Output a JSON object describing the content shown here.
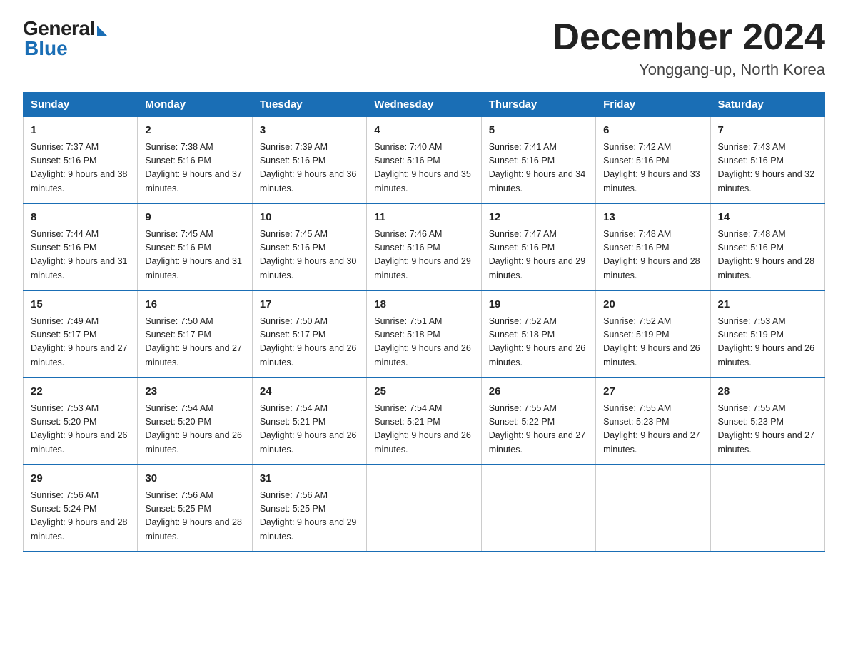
{
  "logo": {
    "general": "General",
    "blue": "Blue"
  },
  "title": "December 2024",
  "location": "Yonggang-up, North Korea",
  "days_of_week": [
    "Sunday",
    "Monday",
    "Tuesday",
    "Wednesday",
    "Thursday",
    "Friday",
    "Saturday"
  ],
  "weeks": [
    [
      {
        "day": "1",
        "sunrise": "Sunrise: 7:37 AM",
        "sunset": "Sunset: 5:16 PM",
        "daylight": "Daylight: 9 hours and 38 minutes."
      },
      {
        "day": "2",
        "sunrise": "Sunrise: 7:38 AM",
        "sunset": "Sunset: 5:16 PM",
        "daylight": "Daylight: 9 hours and 37 minutes."
      },
      {
        "day": "3",
        "sunrise": "Sunrise: 7:39 AM",
        "sunset": "Sunset: 5:16 PM",
        "daylight": "Daylight: 9 hours and 36 minutes."
      },
      {
        "day": "4",
        "sunrise": "Sunrise: 7:40 AM",
        "sunset": "Sunset: 5:16 PM",
        "daylight": "Daylight: 9 hours and 35 minutes."
      },
      {
        "day": "5",
        "sunrise": "Sunrise: 7:41 AM",
        "sunset": "Sunset: 5:16 PM",
        "daylight": "Daylight: 9 hours and 34 minutes."
      },
      {
        "day": "6",
        "sunrise": "Sunrise: 7:42 AM",
        "sunset": "Sunset: 5:16 PM",
        "daylight": "Daylight: 9 hours and 33 minutes."
      },
      {
        "day": "7",
        "sunrise": "Sunrise: 7:43 AM",
        "sunset": "Sunset: 5:16 PM",
        "daylight": "Daylight: 9 hours and 32 minutes."
      }
    ],
    [
      {
        "day": "8",
        "sunrise": "Sunrise: 7:44 AM",
        "sunset": "Sunset: 5:16 PM",
        "daylight": "Daylight: 9 hours and 31 minutes."
      },
      {
        "day": "9",
        "sunrise": "Sunrise: 7:45 AM",
        "sunset": "Sunset: 5:16 PM",
        "daylight": "Daylight: 9 hours and 31 minutes."
      },
      {
        "day": "10",
        "sunrise": "Sunrise: 7:45 AM",
        "sunset": "Sunset: 5:16 PM",
        "daylight": "Daylight: 9 hours and 30 minutes."
      },
      {
        "day": "11",
        "sunrise": "Sunrise: 7:46 AM",
        "sunset": "Sunset: 5:16 PM",
        "daylight": "Daylight: 9 hours and 29 minutes."
      },
      {
        "day": "12",
        "sunrise": "Sunrise: 7:47 AM",
        "sunset": "Sunset: 5:16 PM",
        "daylight": "Daylight: 9 hours and 29 minutes."
      },
      {
        "day": "13",
        "sunrise": "Sunrise: 7:48 AM",
        "sunset": "Sunset: 5:16 PM",
        "daylight": "Daylight: 9 hours and 28 minutes."
      },
      {
        "day": "14",
        "sunrise": "Sunrise: 7:48 AM",
        "sunset": "Sunset: 5:16 PM",
        "daylight": "Daylight: 9 hours and 28 minutes."
      }
    ],
    [
      {
        "day": "15",
        "sunrise": "Sunrise: 7:49 AM",
        "sunset": "Sunset: 5:17 PM",
        "daylight": "Daylight: 9 hours and 27 minutes."
      },
      {
        "day": "16",
        "sunrise": "Sunrise: 7:50 AM",
        "sunset": "Sunset: 5:17 PM",
        "daylight": "Daylight: 9 hours and 27 minutes."
      },
      {
        "day": "17",
        "sunrise": "Sunrise: 7:50 AM",
        "sunset": "Sunset: 5:17 PM",
        "daylight": "Daylight: 9 hours and 26 minutes."
      },
      {
        "day": "18",
        "sunrise": "Sunrise: 7:51 AM",
        "sunset": "Sunset: 5:18 PM",
        "daylight": "Daylight: 9 hours and 26 minutes."
      },
      {
        "day": "19",
        "sunrise": "Sunrise: 7:52 AM",
        "sunset": "Sunset: 5:18 PM",
        "daylight": "Daylight: 9 hours and 26 minutes."
      },
      {
        "day": "20",
        "sunrise": "Sunrise: 7:52 AM",
        "sunset": "Sunset: 5:19 PM",
        "daylight": "Daylight: 9 hours and 26 minutes."
      },
      {
        "day": "21",
        "sunrise": "Sunrise: 7:53 AM",
        "sunset": "Sunset: 5:19 PM",
        "daylight": "Daylight: 9 hours and 26 minutes."
      }
    ],
    [
      {
        "day": "22",
        "sunrise": "Sunrise: 7:53 AM",
        "sunset": "Sunset: 5:20 PM",
        "daylight": "Daylight: 9 hours and 26 minutes."
      },
      {
        "day": "23",
        "sunrise": "Sunrise: 7:54 AM",
        "sunset": "Sunset: 5:20 PM",
        "daylight": "Daylight: 9 hours and 26 minutes."
      },
      {
        "day": "24",
        "sunrise": "Sunrise: 7:54 AM",
        "sunset": "Sunset: 5:21 PM",
        "daylight": "Daylight: 9 hours and 26 minutes."
      },
      {
        "day": "25",
        "sunrise": "Sunrise: 7:54 AM",
        "sunset": "Sunset: 5:21 PM",
        "daylight": "Daylight: 9 hours and 26 minutes."
      },
      {
        "day": "26",
        "sunrise": "Sunrise: 7:55 AM",
        "sunset": "Sunset: 5:22 PM",
        "daylight": "Daylight: 9 hours and 27 minutes."
      },
      {
        "day": "27",
        "sunrise": "Sunrise: 7:55 AM",
        "sunset": "Sunset: 5:23 PM",
        "daylight": "Daylight: 9 hours and 27 minutes."
      },
      {
        "day": "28",
        "sunrise": "Sunrise: 7:55 AM",
        "sunset": "Sunset: 5:23 PM",
        "daylight": "Daylight: 9 hours and 27 minutes."
      }
    ],
    [
      {
        "day": "29",
        "sunrise": "Sunrise: 7:56 AM",
        "sunset": "Sunset: 5:24 PM",
        "daylight": "Daylight: 9 hours and 28 minutes."
      },
      {
        "day": "30",
        "sunrise": "Sunrise: 7:56 AM",
        "sunset": "Sunset: 5:25 PM",
        "daylight": "Daylight: 9 hours and 28 minutes."
      },
      {
        "day": "31",
        "sunrise": "Sunrise: 7:56 AM",
        "sunset": "Sunset: 5:25 PM",
        "daylight": "Daylight: 9 hours and 29 minutes."
      },
      null,
      null,
      null,
      null
    ]
  ]
}
